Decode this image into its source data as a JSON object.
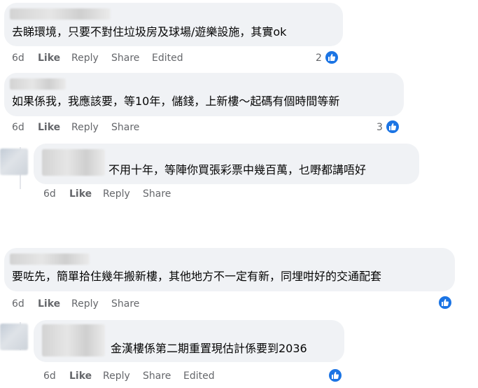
{
  "comments": [
    {
      "text": "去睇環境，只要不對住垃圾房及球場/遊樂設施，其實ok",
      "time": "6d",
      "like": "Like",
      "reply": "Reply",
      "share": "Share",
      "edited": "Edited",
      "reactions": "2"
    },
    {
      "text": "如果係我，我應該要，等10年，儲錢，上新樓～起碼有個時間等新",
      "time": "6d",
      "like": "Like",
      "reply": "Reply",
      "share": "Share",
      "reactions": "3"
    },
    {
      "text": "不用十年，等陣你買張彩票中幾百萬，乜嘢都講唔好",
      "time": "6d",
      "like": "Like",
      "reply": "Reply",
      "share": "Share"
    },
    {
      "text": "要咗先，簡單拾住幾年搬新樓，其他地方不一定有新，同埋咁好的交通配套",
      "time": "6d",
      "like": "Like",
      "reply": "Reply",
      "share": "Share"
    },
    {
      "text": "金漢樓係第二期重置現估計係要到2036",
      "time": "6d",
      "like": "Like",
      "reply": "Reply",
      "share": "Share",
      "edited": "Edited"
    }
  ],
  "icons": {
    "reaction": "like-thumb-icon"
  },
  "colors": {
    "bubble": "#f0f2f5",
    "meta_text": "#65676b",
    "like_blue": "#1b74e4"
  }
}
